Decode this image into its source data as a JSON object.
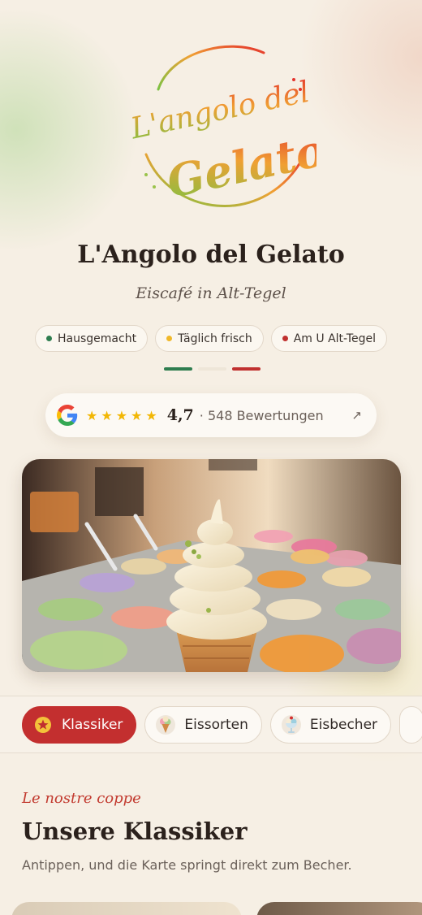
{
  "brand": {
    "logo_line1": "L'angolo del",
    "logo_line2": "Gelato",
    "title": "L'Angolo del Gelato",
    "subtitle": "Eiscafé in Alt-Tegel"
  },
  "highlights": [
    {
      "label": "Hausgemacht",
      "dot_color": "#2e7d4f"
    },
    {
      "label": "Täglich frisch",
      "dot_color": "#f0b829"
    },
    {
      "label": "Am U Alt-Tegel",
      "dot_color": "#c0302f"
    }
  ],
  "flag_colors": [
    "#2e7d4f",
    "#eee6d8",
    "#c0302f"
  ],
  "rating": {
    "provider_icon": "google-g-icon",
    "stars": 5,
    "score": "4,7",
    "reviews": "· 548 Bewertungen",
    "arrow": "↗"
  },
  "hero": {
    "image": "soft-serve-ice-cream-cone-over-gelato-display"
  },
  "tabs": [
    {
      "label": "Klassiker",
      "icon": "star-icon",
      "active": true
    },
    {
      "label": "Eissorten",
      "icon": "ice-cream-cone-icon",
      "active": false
    },
    {
      "label": "Eisbecher",
      "icon": "sundae-icon",
      "active": false
    }
  ],
  "section": {
    "kicker": "Le nostre coppe",
    "title": "Unsere Klassiker",
    "description": "Antippen, und die Karte springt direkt zum Becher."
  },
  "colors": {
    "accent": "#c32f2f",
    "background": "#f6efe4",
    "star": "#f2b705"
  }
}
